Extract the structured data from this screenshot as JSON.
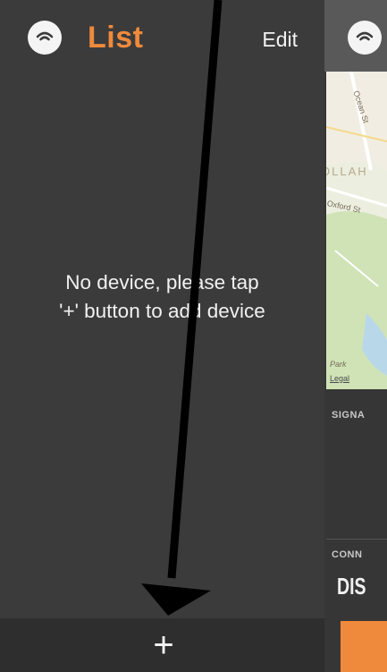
{
  "header": {
    "title": "List",
    "edit_label": "Edit",
    "icon": "wifi-signal-icon"
  },
  "empty_state": {
    "line1": "No device, please tap",
    "line2": "'+' button to add device"
  },
  "bottom_bar": {
    "add_label": "+"
  },
  "detail_panel": {
    "icon": "wifi-signal-icon",
    "map": {
      "street_1": "Ocean St",
      "area": "OLLAH",
      "street_2": "Oxford St",
      "park": "Park",
      "legal": "Legal"
    },
    "signal_label": "SIGNA",
    "connection_label": "CONN",
    "status": "DIS"
  },
  "colors": {
    "accent": "#ef8a3c",
    "background": "#3b3b3b",
    "bottom_bar": "#2e2e2e"
  }
}
